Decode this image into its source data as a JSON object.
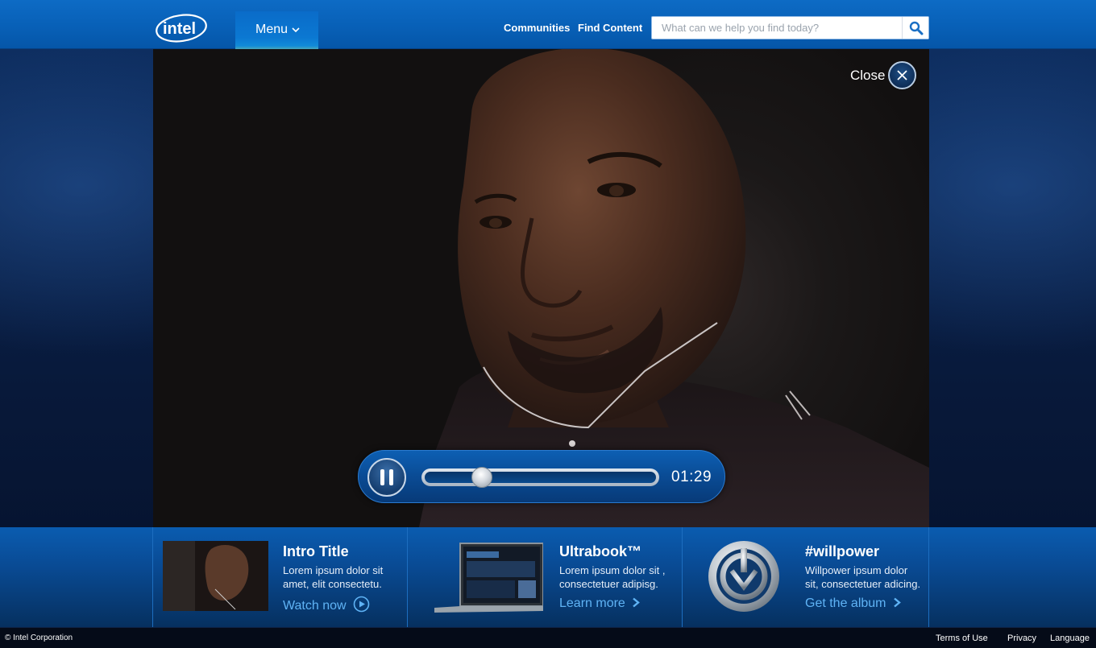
{
  "header": {
    "logo_text": "intel",
    "menu_label": "Menu",
    "nav": [
      "Communities",
      "Find Content"
    ],
    "search_placeholder": "What can we help you find today?"
  },
  "video": {
    "close_label": "Close",
    "time": "01:29",
    "progress": 0.23
  },
  "tiles": [
    {
      "title": "Intro Title",
      "desc": [
        "Lorem ipsum dolor sit",
        "amet, elit consectetu."
      ],
      "link": "Watch now"
    },
    {
      "title": "Ultrabook™",
      "desc": [
        "Lorem ipsum dolor sit ,",
        "consectetuer adipisg."
      ],
      "link": "Learn more"
    },
    {
      "title": "#willpower",
      "desc": [
        "Willpower ipsum dolor",
        "sit, consectetuer adicing."
      ],
      "link": "Get the album"
    }
  ],
  "footer": {
    "copyright": "© Intel Corporation",
    "links": [
      "Terms of Use",
      "Privacy",
      "Language"
    ]
  },
  "colors": {
    "header_blue": "#0860b7",
    "link_blue": "#5fb3f5",
    "player_blue": "#0a4b94"
  },
  "icons": [
    "chevron-down-icon",
    "search-icon",
    "close-icon",
    "pause-icon",
    "play-circle-icon",
    "chevron-right-icon",
    "willpower-logo-icon"
  ]
}
